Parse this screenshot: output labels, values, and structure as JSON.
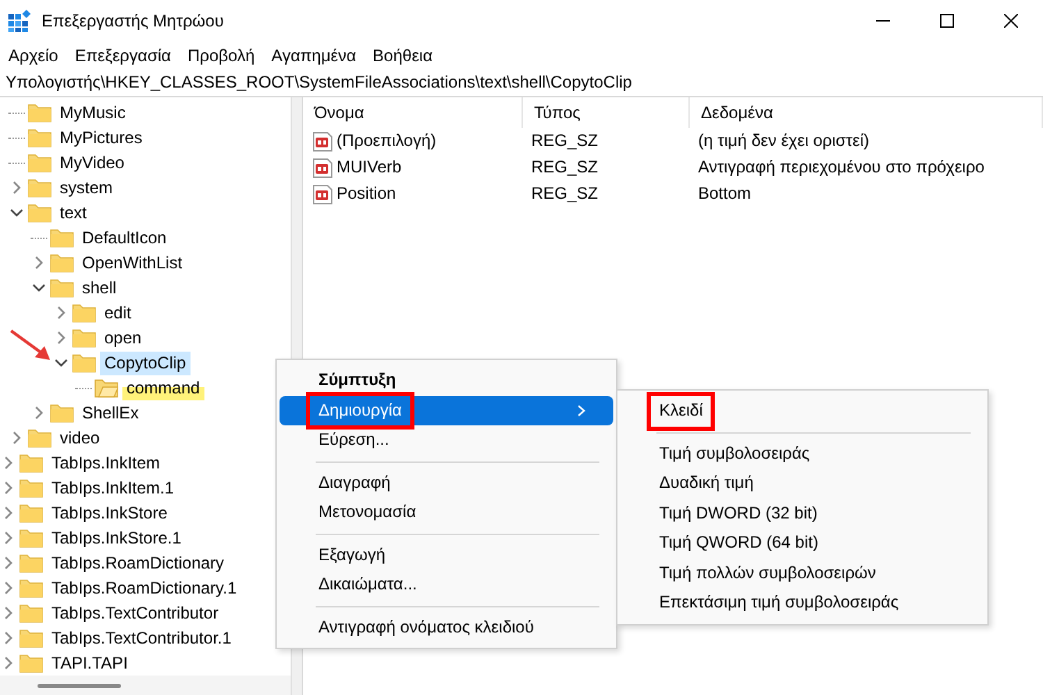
{
  "window": {
    "title": "Επεξεργαστής Μητρώου"
  },
  "menu_bar": [
    "Αρχείο",
    "Επεξεργασία",
    "Προβολή",
    "Αγαπημένα",
    "Βοήθεια"
  ],
  "address": "Υπολογιστής\\HKEY_CLASSES_ROOT\\SystemFileAssociations\\text\\shell\\CopytoClip",
  "tree": [
    {
      "kind": "continuation",
      "children": [
        {
          "label": "MyMusic",
          "selected": false,
          "marked": false
        },
        {
          "label": "MyPictures",
          "selected": false,
          "marked": false
        },
        {
          "label": "MyVideo",
          "selected": false,
          "marked": false
        },
        {
          "label": "system",
          "expanded": false,
          "selected": false,
          "marked": false
        },
        {
          "label": "text",
          "expanded": true,
          "selected": false,
          "marked": false,
          "children": [
            {
              "label": "DefaultIcon",
              "selected": false,
              "marked": false
            },
            {
              "label": "OpenWithList",
              "expanded": false,
              "selected": false,
              "marked": false
            },
            {
              "label": "shell",
              "expanded": true,
              "selected": false,
              "marked": false,
              "children": [
                {
                  "label": "edit",
                  "expanded": false,
                  "selected": false,
                  "marked": false
                },
                {
                  "label": "open",
                  "expanded": false,
                  "selected": false,
                  "marked": false
                },
                {
                  "label": "CopytoClip",
                  "expanded": true,
                  "selected": true,
                  "marked": false,
                  "pointed": true,
                  "children": [
                    {
                      "label": "command",
                      "selected": false,
                      "marked": true
                    }
                  ]
                }
              ]
            },
            {
              "label": "ShellEx",
              "expanded": false,
              "selected": false,
              "marked": false
            }
          ]
        },
        {
          "label": "video",
          "expanded": false,
          "selected": false,
          "marked": false
        }
      ]
    },
    {
      "label": "TabIps.InkItem",
      "expanded": false,
      "selected": false,
      "marked": false
    },
    {
      "label": "TabIps.InkItem.1",
      "expanded": false,
      "selected": false,
      "marked": false
    },
    {
      "label": "TabIps.InkStore",
      "expanded": false,
      "selected": false,
      "marked": false
    },
    {
      "label": "TabIps.InkStore.1",
      "expanded": false,
      "selected": false,
      "marked": false
    },
    {
      "label": "TabIps.RoamDictionary",
      "expanded": false,
      "selected": false,
      "marked": false
    },
    {
      "label": "TabIps.RoamDictionary.1",
      "expanded": false,
      "selected": false,
      "marked": false
    },
    {
      "label": "TabIps.TextContributor",
      "expanded": false,
      "selected": false,
      "marked": false
    },
    {
      "label": "TabIps.TextContributor.1",
      "expanded": false,
      "selected": false,
      "marked": false
    },
    {
      "label": "TAPI.TAPI",
      "expanded": false,
      "selected": false,
      "marked": false
    }
  ],
  "table": {
    "columns": [
      "Όνομα",
      "Τύπος",
      "Δεδομένα"
    ],
    "rows": [
      {
        "name": "(Προεπιλογή)",
        "type": "REG_SZ",
        "data": "(η τιμή δεν έχει οριστεί)"
      },
      {
        "name": "MUIVerb",
        "type": "REG_SZ",
        "data": "Αντιγραφή περιεχομένου στο πρόχειρο"
      },
      {
        "name": "Position",
        "type": "REG_SZ",
        "data": "Bottom"
      }
    ]
  },
  "context_menu": [
    {
      "kind": "item",
      "label": "Σύμπτυξη",
      "default": true,
      "selected": false,
      "submenu": false,
      "boxed": false
    },
    {
      "kind": "item",
      "label": "Δημιουργία",
      "default": false,
      "selected": true,
      "submenu": true,
      "boxed": true
    },
    {
      "kind": "item",
      "label": "Εύρεση...",
      "default": false,
      "selected": false,
      "submenu": false,
      "boxed": false
    },
    {
      "kind": "separator"
    },
    {
      "kind": "item",
      "label": "Διαγραφή",
      "default": false,
      "selected": false,
      "submenu": false,
      "boxed": false
    },
    {
      "kind": "item",
      "label": "Μετονομασία",
      "default": false,
      "selected": false,
      "submenu": false,
      "boxed": false
    },
    {
      "kind": "separator"
    },
    {
      "kind": "item",
      "label": "Εξαγωγή",
      "default": false,
      "selected": false,
      "submenu": false,
      "boxed": false
    },
    {
      "kind": "item",
      "label": "Δικαιώματα...",
      "default": false,
      "selected": false,
      "submenu": false,
      "boxed": false
    },
    {
      "kind": "separator"
    },
    {
      "kind": "item",
      "label": "Αντιγραφή ονόματος κλειδιού",
      "default": false,
      "selected": false,
      "submenu": false,
      "boxed": false
    }
  ],
  "submenu": [
    {
      "kind": "item",
      "label": "Κλειδί",
      "default": false,
      "selected": false,
      "submenu": false,
      "boxed": true
    },
    {
      "kind": "separator"
    },
    {
      "kind": "item",
      "label": "Τιμή συμβολοσειράς",
      "default": false,
      "selected": false,
      "submenu": false,
      "boxed": false
    },
    {
      "kind": "item",
      "label": "Δυαδική τιμή",
      "default": false,
      "selected": false,
      "submenu": false,
      "boxed": false
    },
    {
      "kind": "item",
      "label": "Τιμή DWORD (32 bit)",
      "default": false,
      "selected": false,
      "submenu": false,
      "boxed": false
    },
    {
      "kind": "item",
      "label": "Τιμή QWORD (64 bit)",
      "default": false,
      "selected": false,
      "submenu": false,
      "boxed": false
    },
    {
      "kind": "item",
      "label": "Τιμή πολλών συμβολοσειρών",
      "default": false,
      "selected": false,
      "submenu": false,
      "boxed": false
    },
    {
      "kind": "item",
      "label": "Επεκτάσιμη τιμή συμβολοσειράς",
      "default": false,
      "selected": false,
      "submenu": false,
      "boxed": false
    }
  ]
}
